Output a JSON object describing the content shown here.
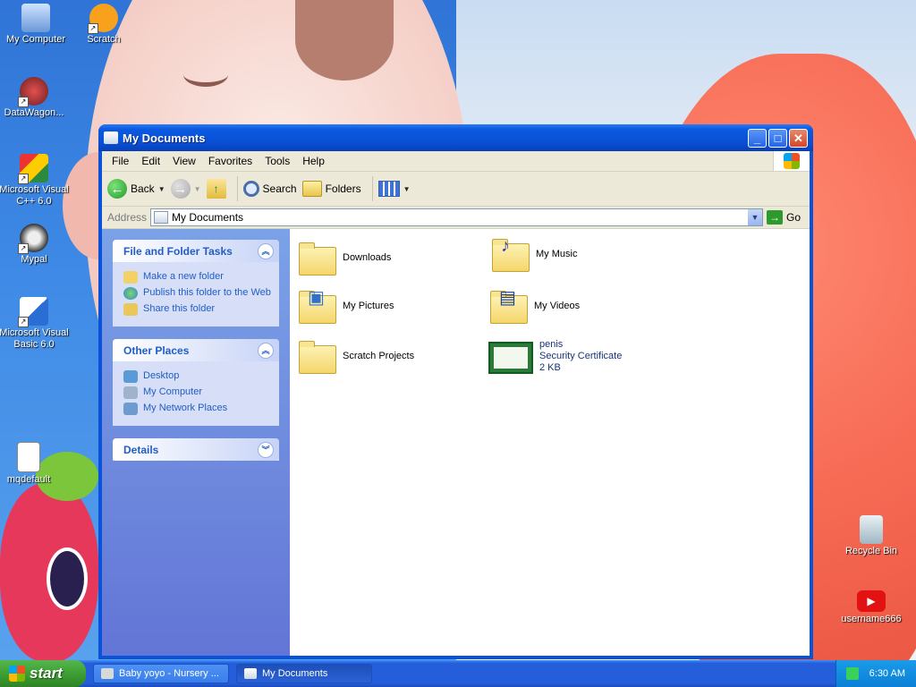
{
  "desktop": {
    "icons": [
      {
        "label": "My Computer",
        "icon": "my-computer-icon"
      },
      {
        "label": "Scratch",
        "icon": "scratch-cat-icon"
      },
      {
        "label": "DataWagon...",
        "icon": "datawagon-icon"
      },
      {
        "label": "Microsoft Visual C++ 6.0",
        "icon": "visual-cpp-icon"
      },
      {
        "label": "Mypal",
        "icon": "mypal-raccoon-icon"
      },
      {
        "label": "Microsoft Visual Basic 6.0",
        "icon": "visual-basic-icon"
      },
      {
        "label": "mqdefault",
        "icon": "image-file-icon"
      },
      {
        "label": "Recycle Bin",
        "icon": "recycle-bin-icon"
      },
      {
        "label": "username666",
        "icon": "youtube-icon"
      }
    ]
  },
  "window": {
    "title": "My Documents",
    "buttons": {
      "minimize": "_",
      "maximize": "□",
      "close": "✕"
    },
    "menu": [
      "File",
      "Edit",
      "View",
      "Favorites",
      "Tools",
      "Help"
    ],
    "toolbar": {
      "back": "Back",
      "search": "Search",
      "folders": "Folders"
    },
    "address": {
      "label": "Address",
      "value": "My Documents",
      "go": "Go"
    },
    "sidebar": {
      "tasks": {
        "title": "File and Folder Tasks",
        "items": [
          "Make a new folder",
          "Publish this folder to the Web",
          "Share this folder"
        ]
      },
      "places": {
        "title": "Other Places",
        "items": [
          "Desktop",
          "My Computer",
          "My Network Places"
        ]
      },
      "details": {
        "title": "Details"
      }
    },
    "files": [
      {
        "name": "Downloads",
        "type": "folder"
      },
      {
        "name": "My Music",
        "type": "music-folder"
      },
      {
        "name": "My Pictures",
        "type": "pictures-folder"
      },
      {
        "name": "My Videos",
        "type": "videos-folder"
      },
      {
        "name": "Scratch Projects",
        "type": "folder"
      },
      {
        "name": "penis",
        "type": "certificate",
        "kind": "Security Certificate",
        "size": "2 KB"
      }
    ]
  },
  "taskbar": {
    "start": "start",
    "tasks": [
      "Baby yoyo - Nursery ...",
      "My Documents"
    ],
    "clock": "6:30 AM"
  },
  "colors": {
    "xp_blue": "#0a53d8",
    "link_blue": "#215dc6",
    "start_green": "#3a9a2f"
  }
}
